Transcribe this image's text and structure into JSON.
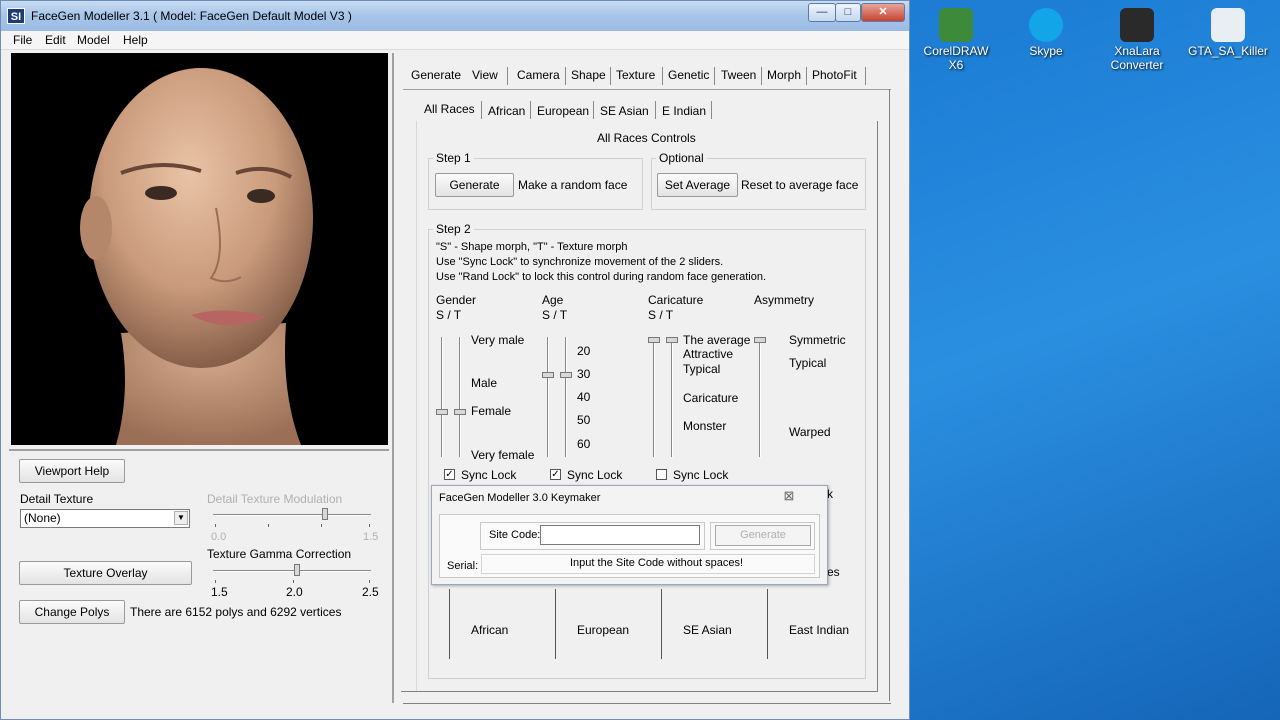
{
  "window": {
    "app_icon": "SI",
    "title": "FaceGen Modeller 3.1  ( Model: FaceGen Default Model V3 )",
    "minimize": "—",
    "maximize": "□",
    "close": "✕"
  },
  "menu": [
    "File",
    "Edit",
    "Model",
    "Help"
  ],
  "left_panel": {
    "viewport_help": "Viewport Help",
    "detail_texture_label": "Detail Texture",
    "detail_texture_value": "(None)",
    "detail_mod_label": "Detail Texture Modulation",
    "detail_mod_min": "0.0",
    "detail_mod_max": "1.5",
    "detail_mod_level": 0.72,
    "texture_overlay": "Texture Overlay",
    "gamma_label": "Texture Gamma Correction",
    "gamma_ticks": [
      "1.5",
      "2.0",
      "2.5"
    ],
    "gamma_level": 0.53,
    "change_polys": "Change Polys",
    "poly_info": "There are 6152 polys and 6292 vertices"
  },
  "tabs": [
    "Generate",
    "View",
    "Camera",
    "Shape",
    "Texture",
    "Genetic",
    "Tween",
    "Morph",
    "PhotoFit"
  ],
  "subtabs": [
    "All Races",
    "African",
    "European",
    "SE Asian",
    "E Indian"
  ],
  "controls": {
    "heading": "All Races Controls",
    "step1_title": "Step 1",
    "generate_btn": "Generate",
    "generate_desc": "Make a random face",
    "optional_title": "Optional",
    "set_average_btn": "Set Average",
    "set_average_desc": "Reset to average face",
    "step2_title": "Step 2",
    "help_lines": [
      "\"S\" - Shape morph, \"T\" - Texture morph",
      "Use \"Sync Lock\" to synchronize movement of the 2 sliders.",
      "Use \"Rand Lock\" to lock this control during random face generation."
    ],
    "gender": {
      "title": "Gender",
      "st": "S / T",
      "labels": [
        "Very male",
        "Male",
        "Female",
        "Very female"
      ]
    },
    "age": {
      "title": "Age",
      "st": "S / T",
      "labels": [
        "20",
        "30",
        "40",
        "50",
        "60"
      ]
    },
    "caricature": {
      "title": "Caricature",
      "st": "S / T",
      "labels": [
        "The average",
        "Attractive",
        "Typical",
        "Caricature",
        "Monster"
      ]
    },
    "asymmetry": {
      "title": "Asymmetry",
      "labels": [
        "Symmetric",
        "Typical",
        "Warped"
      ]
    },
    "sync_lock": "Sync Lock",
    "partial_k": "k",
    "partial_es": "es",
    "races": [
      "African",
      "European",
      "SE Asian",
      "East Indian"
    ]
  },
  "keymaker": {
    "title": "FaceGen Modeller 3.0 Keymaker",
    "close": "⊠",
    "site_code_label": "Site Code:",
    "generate_btn": "Generate",
    "serial_label": "Serial:",
    "hint": "Input the Site Code without spaces!"
  },
  "desktop": [
    {
      "label": "CorelDRAW X6",
      "color": "#3c8a3a",
      "icon": "coreldraw-icon"
    },
    {
      "label": "Skype",
      "color": "#12a5e8",
      "icon": "skype-icon"
    },
    {
      "label": "XnaLara Converter",
      "color": "#2a2a2a",
      "icon": "xnalara-icon"
    },
    {
      "label": "GTA_SA_Killer",
      "color": "#e8eef4",
      "icon": "gta-icon"
    }
  ]
}
